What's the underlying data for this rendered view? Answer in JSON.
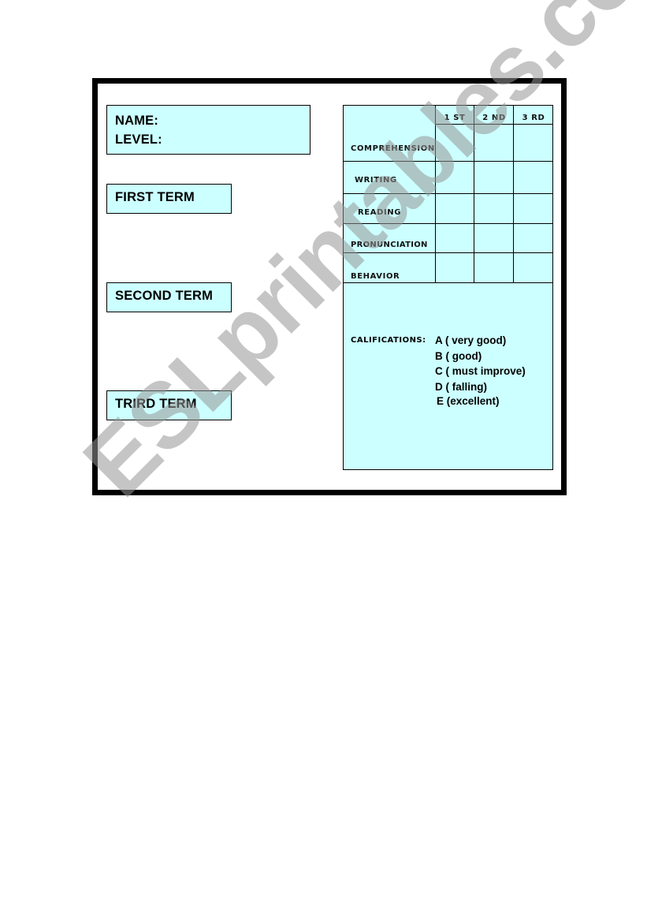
{
  "student_info": {
    "name_label": "NAME:",
    "level_label": "LEVEL:"
  },
  "terms": [
    {
      "label": "FIRST TERM"
    },
    {
      "label": "SECOND TERM"
    },
    {
      "label": "TRIRD TERM"
    }
  ],
  "grades_table": {
    "columns": [
      "1 ST",
      "2 ND",
      "3 RD"
    ],
    "rows": [
      {
        "label": "COMPREHENSION",
        "values": [
          "",
          "",
          ""
        ]
      },
      {
        "label": "WRITING",
        "values": [
          "",
          "",
          ""
        ]
      },
      {
        "label": "READING",
        "values": [
          "",
          "",
          ""
        ]
      },
      {
        "label": "PRONUNCIATION",
        "values": [
          "",
          "",
          ""
        ]
      },
      {
        "label": "BEHAVIOR",
        "values": [
          "",
          "",
          ""
        ]
      }
    ]
  },
  "qualifications": {
    "title": "CALIFICATIONS:",
    "items": [
      "A ( very good)",
      "B ( good)",
      "C ( must improve)",
      "D ( falling)",
      "E (excellent)"
    ]
  },
  "watermark": "ESLprintables.com",
  "colors": {
    "box_fill": "#ccffff",
    "border": "#000000"
  }
}
